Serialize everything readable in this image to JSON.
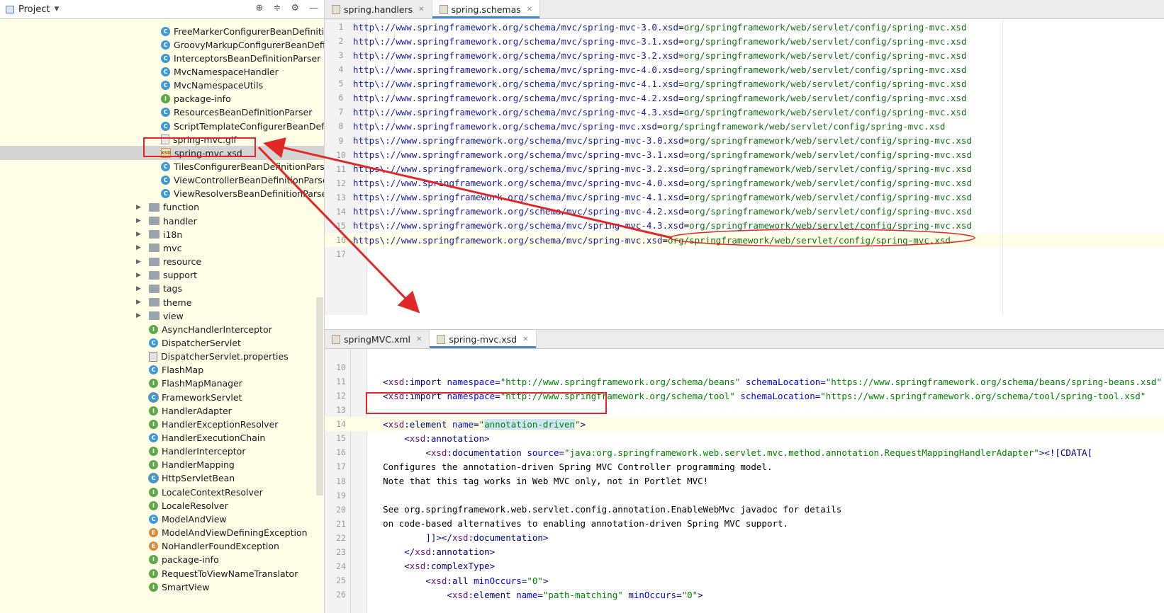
{
  "project_panel": {
    "title": "Project",
    "tree": [
      {
        "label": "FreeMarkerConfigurerBeanDefinitio",
        "icon": "class-icon"
      },
      {
        "label": "GroovyMarkupConfigurerBeanDefini",
        "icon": "class-icon"
      },
      {
        "label": "InterceptorsBeanDefinitionParser",
        "icon": "class-icon"
      },
      {
        "label": "MvcNamespaceHandler",
        "icon": "class-icon"
      },
      {
        "label": "MvcNamespaceUtils",
        "icon": "class-icon"
      },
      {
        "label": "package-info",
        "icon": "interface-icon"
      },
      {
        "label": "ResourcesBeanDefinitionParser",
        "icon": "class-icon"
      },
      {
        "label": "ScriptTemplateConfigurerBeanDefini",
        "icon": "class-icon"
      },
      {
        "label": "spring-mvc.gif",
        "icon": "image-file-icon"
      },
      {
        "label": "spring-mvc.xsd",
        "icon": "xsd-file-icon"
      },
      {
        "label": "TilesConfigurerBeanDefinitionParse",
        "icon": "class-icon"
      },
      {
        "label": "ViewControllerBeanDefinitionParser",
        "icon": "class-icon"
      },
      {
        "label": "ViewResolversBeanDefinitionParser",
        "icon": "class-icon"
      },
      {
        "label": "function",
        "icon": "folder-icon"
      },
      {
        "label": "handler",
        "icon": "folder-icon"
      },
      {
        "label": "i18n",
        "icon": "folder-icon"
      },
      {
        "label": "mvc",
        "icon": "folder-icon"
      },
      {
        "label": "resource",
        "icon": "folder-icon"
      },
      {
        "label": "support",
        "icon": "folder-icon"
      },
      {
        "label": "tags",
        "icon": "folder-icon"
      },
      {
        "label": "theme",
        "icon": "folder-icon"
      },
      {
        "label": "view",
        "icon": "folder-icon"
      },
      {
        "label": "AsyncHandlerInterceptor",
        "icon": "interface-icon"
      },
      {
        "label": "DispatcherServlet",
        "icon": "class-icon"
      },
      {
        "label": "DispatcherServlet.properties",
        "icon": "properties-file-icon"
      },
      {
        "label": "FlashMap",
        "icon": "class-icon"
      },
      {
        "label": "FlashMapManager",
        "icon": "interface-icon"
      },
      {
        "label": "FrameworkServlet",
        "icon": "abstract-class-icon"
      },
      {
        "label": "HandlerAdapter",
        "icon": "interface-icon"
      },
      {
        "label": "HandlerExceptionResolver",
        "icon": "interface-icon"
      },
      {
        "label": "HandlerExecutionChain",
        "icon": "class-icon"
      },
      {
        "label": "HandlerInterceptor",
        "icon": "interface-icon"
      },
      {
        "label": "HandlerMapping",
        "icon": "interface-icon"
      },
      {
        "label": "HttpServletBean",
        "icon": "abstract-class-icon"
      },
      {
        "label": "LocaleContextResolver",
        "icon": "interface-icon"
      },
      {
        "label": "LocaleResolver",
        "icon": "interface-icon"
      },
      {
        "label": "ModelAndView",
        "icon": "class-icon"
      },
      {
        "label": "ModelAndViewDefiningException",
        "icon": "exception-icon"
      },
      {
        "label": "NoHandlerFoundException",
        "icon": "exception-icon"
      },
      {
        "label": "package-info",
        "icon": "interface-icon"
      },
      {
        "label": "RequestToViewNameTranslator",
        "icon": "interface-icon"
      },
      {
        "label": "SmartView",
        "icon": "interface-icon"
      }
    ]
  },
  "top_editor": {
    "tabs": [
      {
        "label": "spring.handlers",
        "active": false
      },
      {
        "label": "spring.schemas",
        "active": true
      }
    ],
    "lines": [
      {
        "key": "http\\://www.springframework.org/schema/mvc/spring-mvc-3.0.xsd",
        "value": "org/springframework/web/servlet/config/spring-mvc.xsd"
      },
      {
        "key": "http\\://www.springframework.org/schema/mvc/spring-mvc-3.1.xsd",
        "value": "org/springframework/web/servlet/config/spring-mvc.xsd"
      },
      {
        "key": "http\\://www.springframework.org/schema/mvc/spring-mvc-3.2.xsd",
        "value": "org/springframework/web/servlet/config/spring-mvc.xsd"
      },
      {
        "key": "http\\://www.springframework.org/schema/mvc/spring-mvc-4.0.xsd",
        "value": "org/springframework/web/servlet/config/spring-mvc.xsd"
      },
      {
        "key": "http\\://www.springframework.org/schema/mvc/spring-mvc-4.1.xsd",
        "value": "org/springframework/web/servlet/config/spring-mvc.xsd"
      },
      {
        "key": "http\\://www.springframework.org/schema/mvc/spring-mvc-4.2.xsd",
        "value": "org/springframework/web/servlet/config/spring-mvc.xsd"
      },
      {
        "key": "http\\://www.springframework.org/schema/mvc/spring-mvc-4.3.xsd",
        "value": "org/springframework/web/servlet/config/spring-mvc.xsd"
      },
      {
        "key": "http\\://www.springframework.org/schema/mvc/spring-mvc.xsd",
        "value": "org/springframework/web/servlet/config/spring-mvc.xsd"
      },
      {
        "key": "https\\://www.springframework.org/schema/mvc/spring-mvc-3.0.xsd",
        "value": "org/springframework/web/servlet/config/spring-mvc.xsd"
      },
      {
        "key": "https\\://www.springframework.org/schema/mvc/spring-mvc-3.1.xsd",
        "value": "org/springframework/web/servlet/config/spring-mvc.xsd"
      },
      {
        "key": "https\\://www.springframework.org/schema/mvc/spring-mvc-3.2.xsd",
        "value": "org/springframework/web/servlet/config/spring-mvc.xsd"
      },
      {
        "key": "https\\://www.springframework.org/schema/mvc/spring-mvc-4.0.xsd",
        "value": "org/springframework/web/servlet/config/spring-mvc.xsd"
      },
      {
        "key": "https\\://www.springframework.org/schema/mvc/spring-mvc-4.1.xsd",
        "value": "org/springframework/web/servlet/config/spring-mvc.xsd"
      },
      {
        "key": "https\\://www.springframework.org/schema/mvc/spring-mvc-4.2.xsd",
        "value": "org/springframework/web/servlet/config/spring-mvc.xsd"
      },
      {
        "key": "https\\://www.springframework.org/schema/mvc/spring-mvc-4.3.xsd",
        "value": "org/springframework/web/servlet/config/spring-mvc.xsd"
      },
      {
        "key": "https\\://www.springframework.org/schema/mvc/spring-mvc.xsd",
        "value": "org/springframework/web/servlet/config/spring-mvc.xsd"
      },
      {
        "key": "",
        "value": ""
      }
    ]
  },
  "bottom_editor": {
    "tabs": [
      {
        "label": "springMVC.xml",
        "active": false
      },
      {
        "label": "spring-mvc.xsd",
        "active": true
      }
    ],
    "first_line": 10,
    "lines": [
      [],
      [
        {
          "t": "    "
        },
        {
          "c": "tag",
          "t": "<"
        },
        {
          "c": "ns",
          "t": "xsd"
        },
        {
          "c": "tag",
          "t": ":import "
        },
        {
          "c": "attr",
          "t": "namespace"
        },
        {
          "c": "tag",
          "t": "="
        },
        {
          "c": "str",
          "t": "\"http://www.springframework.org/schema/beans\""
        },
        {
          "t": " "
        },
        {
          "c": "attr",
          "t": "schemaLocation"
        },
        {
          "c": "tag",
          "t": "="
        },
        {
          "c": "str",
          "t": "\"https://www.springframework.org/schema/beans/spring-beans.xsd\""
        }
      ],
      [
        {
          "t": "    "
        },
        {
          "c": "tag",
          "t": "<"
        },
        {
          "c": "ns",
          "t": "xsd"
        },
        {
          "c": "tag",
          "t": ":import "
        },
        {
          "c": "attr",
          "t": "namespace"
        },
        {
          "c": "tag",
          "t": "="
        },
        {
          "c": "str",
          "t": "\"http://www.springframework.org/schema/tool\""
        },
        {
          "t": " "
        },
        {
          "c": "attr",
          "t": "schemaLocation"
        },
        {
          "c": "tag",
          "t": "="
        },
        {
          "c": "str",
          "t": "\"https://www.springframework.org/schema/tool/spring-tool.xsd\""
        }
      ],
      [],
      [
        {
          "t": "    "
        },
        {
          "c": "tag",
          "t": "<"
        },
        {
          "c": "ns",
          "t": "xsd"
        },
        {
          "c": "tag",
          "t": ":element "
        },
        {
          "c": "attr",
          "t": "name"
        },
        {
          "c": "tag",
          "t": "="
        },
        {
          "c": "str",
          "t": "\""
        },
        {
          "c": "str hl",
          "t": "annotation-driven"
        },
        {
          "c": "str",
          "t": "\""
        },
        {
          "c": "tag",
          "t": ">"
        }
      ],
      [
        {
          "t": "        "
        },
        {
          "c": "tag",
          "t": "<"
        },
        {
          "c": "ns",
          "t": "xsd"
        },
        {
          "c": "tag",
          "t": ":annotation>"
        }
      ],
      [
        {
          "t": "            "
        },
        {
          "c": "tag",
          "t": "<"
        },
        {
          "c": "ns",
          "t": "xsd"
        },
        {
          "c": "tag",
          "t": ":documentation "
        },
        {
          "c": "attr",
          "t": "source"
        },
        {
          "c": "tag",
          "t": "="
        },
        {
          "c": "str",
          "t": "\"java:org.springframework.web.servlet.mvc.method.annotation.RequestMappingHandlerAdapter\""
        },
        {
          "c": "tag",
          "t": "><![CDATA["
        }
      ],
      [
        {
          "t": "    Configures the annotation-driven Spring MVC Controller programming model."
        }
      ],
      [
        {
          "t": "    Note that this tag works in Web MVC only, not in Portlet MVC!"
        }
      ],
      [],
      [
        {
          "t": "    See org.springframework.web.servlet.config.annotation.EnableWebMvc javadoc for details"
        }
      ],
      [
        {
          "t": "    on code-based alternatives to enabling annotation-driven Spring MVC support."
        }
      ],
      [
        {
          "t": "            "
        },
        {
          "c": "tag",
          "t": "]]></"
        },
        {
          "c": "ns",
          "t": "xsd"
        },
        {
          "c": "tag",
          "t": ":documentation>"
        }
      ],
      [
        {
          "t": "        "
        },
        {
          "c": "tag",
          "t": "</"
        },
        {
          "c": "ns",
          "t": "xsd"
        },
        {
          "c": "tag",
          "t": ":annotation>"
        }
      ],
      [
        {
          "t": "        "
        },
        {
          "c": "tag",
          "t": "<"
        },
        {
          "c": "ns",
          "t": "xsd"
        },
        {
          "c": "tag",
          "t": ":complexType>"
        }
      ],
      [
        {
          "t": "            "
        },
        {
          "c": "tag",
          "t": "<"
        },
        {
          "c": "ns",
          "t": "xsd"
        },
        {
          "c": "tag",
          "t": ":all "
        },
        {
          "c": "attr",
          "t": "minOccurs"
        },
        {
          "c": "tag",
          "t": "="
        },
        {
          "c": "str",
          "t": "\"0\""
        },
        {
          "c": "tag",
          "t": ">"
        }
      ],
      [
        {
          "t": "                "
        },
        {
          "c": "tag",
          "t": "<"
        },
        {
          "c": "ns",
          "t": "xsd"
        },
        {
          "c": "tag",
          "t": ":element "
        },
        {
          "c": "attr",
          "t": "name"
        },
        {
          "c": "tag",
          "t": "="
        },
        {
          "c": "str",
          "t": "\"path-matching\""
        },
        {
          "t": " "
        },
        {
          "c": "attr",
          "t": "minOccurs"
        },
        {
          "c": "tag",
          "t": "="
        },
        {
          "c": "str",
          "t": "\"0\""
        },
        {
          "c": "tag",
          "t": ">"
        }
      ]
    ]
  }
}
